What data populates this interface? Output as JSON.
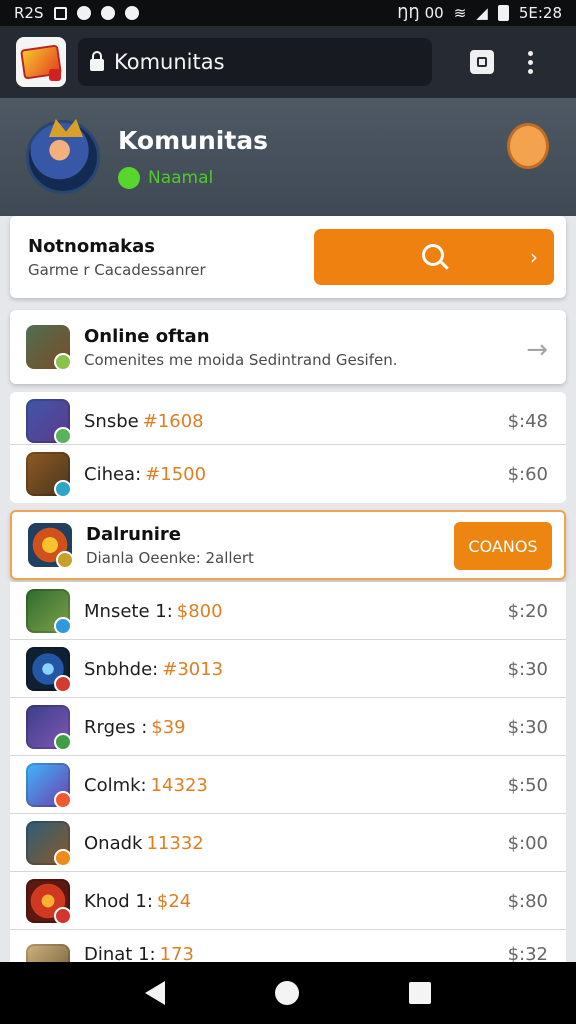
{
  "status": {
    "left_icons": [
      "R2S",
      "□",
      "●",
      "●",
      "●"
    ],
    "right_text": "5E:28",
    "carrier": "ŊŊ 00"
  },
  "browser": {
    "url": "Komunitas"
  },
  "profile": {
    "title": "Komunitas",
    "status": "Naamal"
  },
  "search": {
    "title": "Notnomakas",
    "subtitle": "Garme r Cacadessanrer"
  },
  "online": {
    "title": "Online oftan",
    "subtitle": "Comenites me moida  Sedintrand Gesifen."
  },
  "rows": [
    {
      "label": "Snsbe",
      "mid": "#1608",
      "price": "$:48"
    },
    {
      "label": "Cihea:",
      "mid": "#1500",
      "price": "$:60"
    },
    {
      "label": "Mnsete 1:",
      "mid": "$800",
      "price": "$:20"
    },
    {
      "label": "Snbhde:",
      "mid": "#3013",
      "price": "$:30"
    },
    {
      "label": "Rrges :",
      "mid": "$39",
      "price": "$:30"
    },
    {
      "label": "Colmk:",
      "mid": "14323",
      "price": "$:50"
    },
    {
      "label": "Onadk",
      "mid": "11332",
      "price": "$:00"
    },
    {
      "label": "Khod 1:",
      "mid": "$24",
      "price": "$:80"
    },
    {
      "label": "Dinat 1:",
      "mid": "173",
      "price": "$:32"
    }
  ],
  "highlight": {
    "title": "Dalrunire",
    "subtitle": "Dianla Oeenke: 2allert",
    "button": "COANOS"
  },
  "colors": {
    "accent": "#EE8110",
    "hero": "#4F5964",
    "panel": "#FFFFFF"
  }
}
